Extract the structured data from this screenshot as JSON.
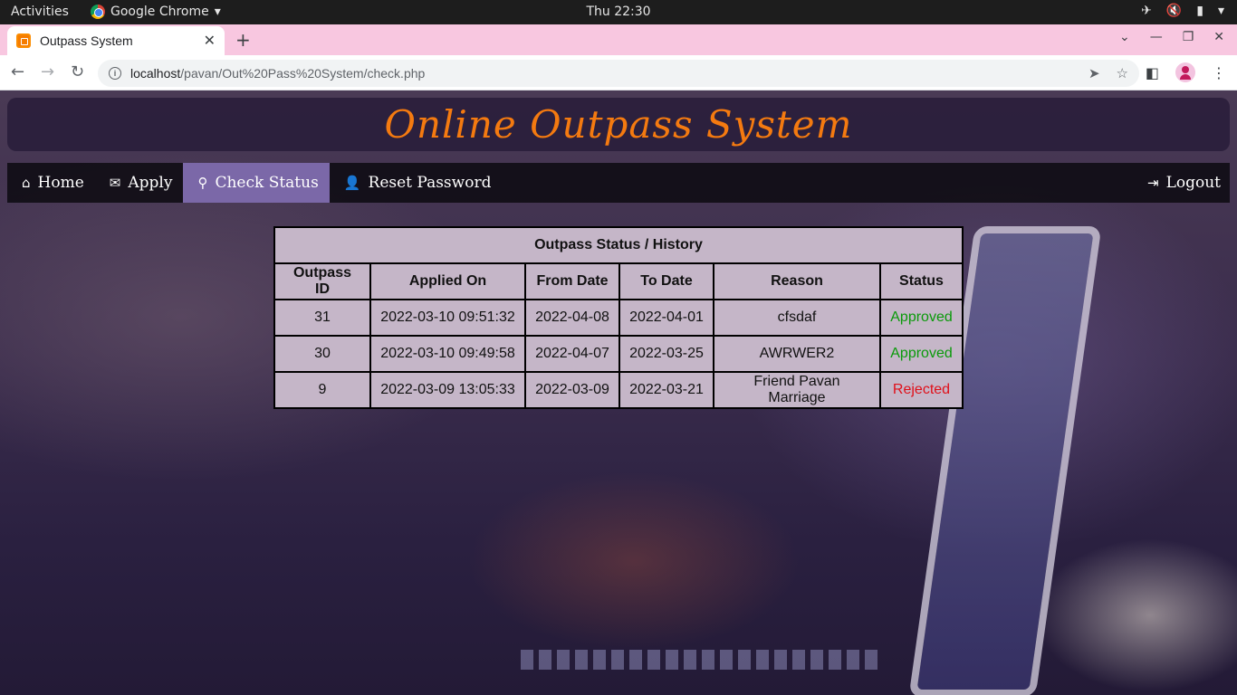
{
  "system_bar": {
    "activities": "Activities",
    "app_name": "Google Chrome",
    "clock": "Thu 22:30"
  },
  "browser": {
    "tab_title": "Outpass System",
    "url_host": "localhost",
    "url_path": "/pavan/Out%20Pass%20System/check.php"
  },
  "site": {
    "title": "Online Outpass System"
  },
  "nav": {
    "home": "Home",
    "apply": "Apply",
    "check_status": "Check Status",
    "reset_password": "Reset Password",
    "logout": "Logout"
  },
  "table": {
    "caption": "Outpass Status / History",
    "headers": [
      "Outpass ID",
      "Applied On",
      "From Date",
      "To Date",
      "Reason",
      "Status"
    ],
    "rows": [
      [
        "31",
        "2022-03-10 09:51:32",
        "2022-04-08",
        "2022-04-01",
        "cfsdaf",
        "Approved"
      ],
      [
        "30",
        "2022-03-10 09:49:58",
        "2022-04-07",
        "2022-03-25",
        "AWRWER2",
        "Approved"
      ],
      [
        "9",
        "2022-03-09 13:05:33",
        "2022-03-09",
        "2022-03-21",
        "Friend Pavan Marriage",
        "Rejected"
      ]
    ]
  },
  "colors": {
    "title_orange": "#f47a10",
    "nav_active": "#7b68a8",
    "approved": "#0a9a0a",
    "rejected": "#e0101a"
  }
}
